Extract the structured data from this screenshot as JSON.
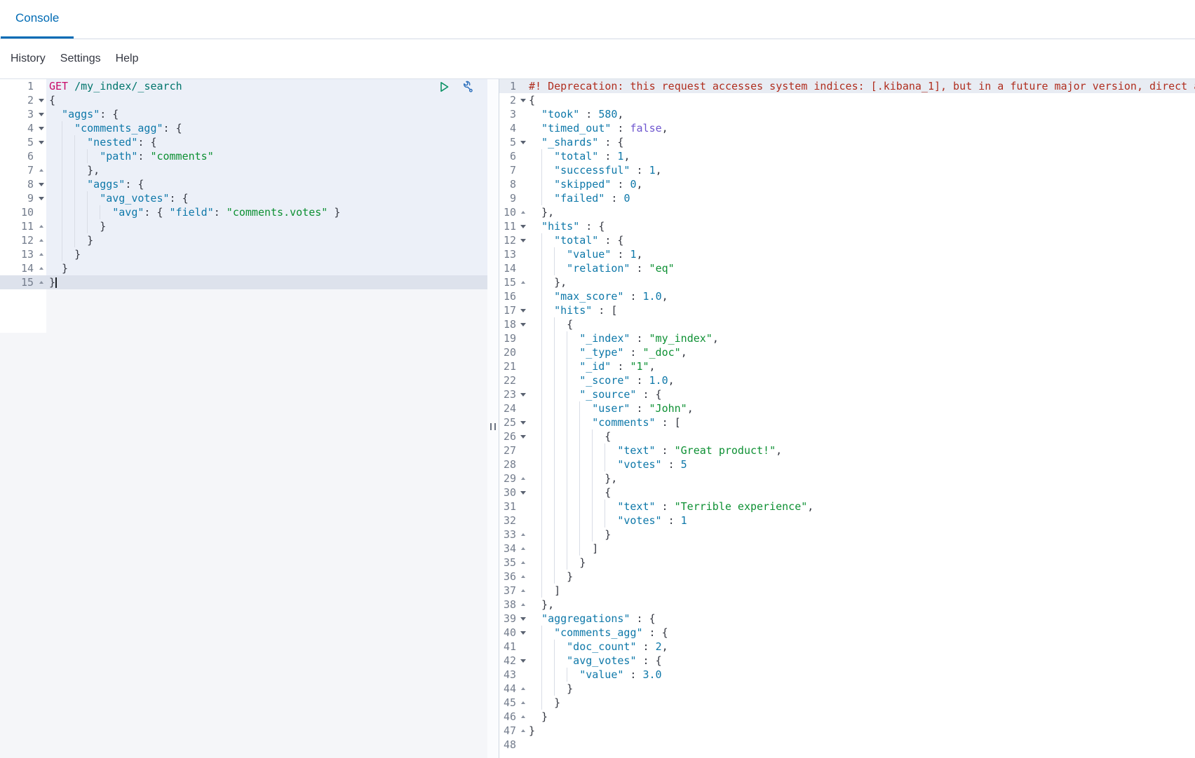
{
  "palette": {
    "accent": "#006bb4",
    "method": "#c80a68",
    "url": "#00756c",
    "key": "#0e78a9",
    "str": "#0d9033",
    "num": "#0e78a9",
    "bool": "#6e56cf",
    "punct": "#343741",
    "warn": "#b02e1f",
    "play_icon": "#0a9164",
    "wrench_icon": "#2a6ebb"
  },
  "tabs": {
    "console": "Console"
  },
  "menu": {
    "history": "History",
    "settings": "Settings",
    "help": "Help"
  },
  "request_editor": {
    "lines": [
      {
        "n": 1,
        "fold": "",
        "indent": 0,
        "tokens": [
          [
            "method",
            "GET "
          ],
          [
            "url",
            "/my_index/_search"
          ]
        ]
      },
      {
        "n": 2,
        "fold": "open",
        "indent": 0,
        "tokens": [
          [
            "punct",
            "{"
          ]
        ]
      },
      {
        "n": 3,
        "fold": "open",
        "indent": 1,
        "tokens": [
          [
            "key",
            "\"aggs\""
          ],
          [
            "punct",
            ": {"
          ]
        ]
      },
      {
        "n": 4,
        "fold": "open",
        "indent": 2,
        "tokens": [
          [
            "key",
            "\"comments_agg\""
          ],
          [
            "punct",
            ": {"
          ]
        ]
      },
      {
        "n": 5,
        "fold": "open",
        "indent": 3,
        "tokens": [
          [
            "key",
            "\"nested\""
          ],
          [
            "punct",
            ": {"
          ]
        ]
      },
      {
        "n": 6,
        "fold": "",
        "indent": 4,
        "tokens": [
          [
            "key",
            "\"path\""
          ],
          [
            "punct",
            ": "
          ],
          [
            "str",
            "\"comments\""
          ]
        ]
      },
      {
        "n": 7,
        "fold": "close",
        "indent": 3,
        "tokens": [
          [
            "punct",
            "},"
          ]
        ]
      },
      {
        "n": 8,
        "fold": "open",
        "indent": 3,
        "tokens": [
          [
            "key",
            "\"aggs\""
          ],
          [
            "punct",
            ": {"
          ]
        ]
      },
      {
        "n": 9,
        "fold": "open",
        "indent": 4,
        "tokens": [
          [
            "key",
            "\"avg_votes\""
          ],
          [
            "punct",
            ": {"
          ]
        ]
      },
      {
        "n": 10,
        "fold": "",
        "indent": 5,
        "tokens": [
          [
            "key",
            "\"avg\""
          ],
          [
            "punct",
            ": { "
          ],
          [
            "key",
            "\"field\""
          ],
          [
            "punct",
            ": "
          ],
          [
            "str",
            "\"comments.votes\""
          ],
          [
            "punct",
            " }"
          ]
        ]
      },
      {
        "n": 11,
        "fold": "close",
        "indent": 4,
        "tokens": [
          [
            "punct",
            "}"
          ]
        ]
      },
      {
        "n": 12,
        "fold": "close",
        "indent": 3,
        "tokens": [
          [
            "punct",
            "}"
          ]
        ]
      },
      {
        "n": 13,
        "fold": "close",
        "indent": 2,
        "tokens": [
          [
            "punct",
            "}"
          ]
        ]
      },
      {
        "n": 14,
        "fold": "close",
        "indent": 1,
        "tokens": [
          [
            "punct",
            "}"
          ]
        ]
      },
      {
        "n": 15,
        "fold": "close",
        "indent": 0,
        "active": true,
        "cursor": true,
        "tokens": [
          [
            "punct",
            "}"
          ]
        ]
      }
    ]
  },
  "response_editor": {
    "lines": [
      {
        "n": 1,
        "fold": "",
        "indent": 0,
        "highlight": true,
        "tokens": [
          [
            "warn",
            "#! Deprecation: this request accesses system indices: [.kibana_1], but in a future major version, direct access"
          ]
        ]
      },
      {
        "n": 2,
        "fold": "open",
        "indent": 0,
        "tokens": [
          [
            "punct",
            "{"
          ]
        ]
      },
      {
        "n": 3,
        "fold": "",
        "indent": 1,
        "tokens": [
          [
            "key",
            "\"took\""
          ],
          [
            "punct",
            " : "
          ],
          [
            "num",
            "580"
          ],
          [
            "punct",
            ","
          ]
        ]
      },
      {
        "n": 4,
        "fold": "",
        "indent": 1,
        "tokens": [
          [
            "key",
            "\"timed_out\""
          ],
          [
            "punct",
            " : "
          ],
          [
            "bool",
            "false"
          ],
          [
            "punct",
            ","
          ]
        ]
      },
      {
        "n": 5,
        "fold": "open",
        "indent": 1,
        "tokens": [
          [
            "key",
            "\"_shards\""
          ],
          [
            "punct",
            " : {"
          ]
        ]
      },
      {
        "n": 6,
        "fold": "",
        "indent": 2,
        "tokens": [
          [
            "key",
            "\"total\""
          ],
          [
            "punct",
            " : "
          ],
          [
            "num",
            "1"
          ],
          [
            "punct",
            ","
          ]
        ]
      },
      {
        "n": 7,
        "fold": "",
        "indent": 2,
        "tokens": [
          [
            "key",
            "\"successful\""
          ],
          [
            "punct",
            " : "
          ],
          [
            "num",
            "1"
          ],
          [
            "punct",
            ","
          ]
        ]
      },
      {
        "n": 8,
        "fold": "",
        "indent": 2,
        "tokens": [
          [
            "key",
            "\"skipped\""
          ],
          [
            "punct",
            " : "
          ],
          [
            "num",
            "0"
          ],
          [
            "punct",
            ","
          ]
        ]
      },
      {
        "n": 9,
        "fold": "",
        "indent": 2,
        "tokens": [
          [
            "key",
            "\"failed\""
          ],
          [
            "punct",
            " : "
          ],
          [
            "num",
            "0"
          ]
        ]
      },
      {
        "n": 10,
        "fold": "close",
        "indent": 1,
        "tokens": [
          [
            "punct",
            "},"
          ]
        ]
      },
      {
        "n": 11,
        "fold": "open",
        "indent": 1,
        "tokens": [
          [
            "key",
            "\"hits\""
          ],
          [
            "punct",
            " : {"
          ]
        ]
      },
      {
        "n": 12,
        "fold": "open",
        "indent": 2,
        "tokens": [
          [
            "key",
            "\"total\""
          ],
          [
            "punct",
            " : {"
          ]
        ]
      },
      {
        "n": 13,
        "fold": "",
        "indent": 3,
        "tokens": [
          [
            "key",
            "\"value\""
          ],
          [
            "punct",
            " : "
          ],
          [
            "num",
            "1"
          ],
          [
            "punct",
            ","
          ]
        ]
      },
      {
        "n": 14,
        "fold": "",
        "indent": 3,
        "tokens": [
          [
            "key",
            "\"relation\""
          ],
          [
            "punct",
            " : "
          ],
          [
            "str",
            "\"eq\""
          ]
        ]
      },
      {
        "n": 15,
        "fold": "close",
        "indent": 2,
        "tokens": [
          [
            "punct",
            "},"
          ]
        ]
      },
      {
        "n": 16,
        "fold": "",
        "indent": 2,
        "tokens": [
          [
            "key",
            "\"max_score\""
          ],
          [
            "punct",
            " : "
          ],
          [
            "num",
            "1.0"
          ],
          [
            "punct",
            ","
          ]
        ]
      },
      {
        "n": 17,
        "fold": "open",
        "indent": 2,
        "tokens": [
          [
            "key",
            "\"hits\""
          ],
          [
            "punct",
            " : ["
          ]
        ]
      },
      {
        "n": 18,
        "fold": "open",
        "indent": 3,
        "tokens": [
          [
            "punct",
            "{"
          ]
        ]
      },
      {
        "n": 19,
        "fold": "",
        "indent": 4,
        "tokens": [
          [
            "key",
            "\"_index\""
          ],
          [
            "punct",
            " : "
          ],
          [
            "str",
            "\"my_index\""
          ],
          [
            "punct",
            ","
          ]
        ]
      },
      {
        "n": 20,
        "fold": "",
        "indent": 4,
        "tokens": [
          [
            "key",
            "\"_type\""
          ],
          [
            "punct",
            " : "
          ],
          [
            "str",
            "\"_doc\""
          ],
          [
            "punct",
            ","
          ]
        ]
      },
      {
        "n": 21,
        "fold": "",
        "indent": 4,
        "tokens": [
          [
            "key",
            "\"_id\""
          ],
          [
            "punct",
            " : "
          ],
          [
            "str",
            "\"1\""
          ],
          [
            "punct",
            ","
          ]
        ]
      },
      {
        "n": 22,
        "fold": "",
        "indent": 4,
        "tokens": [
          [
            "key",
            "\"_score\""
          ],
          [
            "punct",
            " : "
          ],
          [
            "num",
            "1.0"
          ],
          [
            "punct",
            ","
          ]
        ]
      },
      {
        "n": 23,
        "fold": "open",
        "indent": 4,
        "tokens": [
          [
            "key",
            "\"_source\""
          ],
          [
            "punct",
            " : {"
          ]
        ]
      },
      {
        "n": 24,
        "fold": "",
        "indent": 5,
        "tokens": [
          [
            "key",
            "\"user\""
          ],
          [
            "punct",
            " : "
          ],
          [
            "str",
            "\"John\""
          ],
          [
            "punct",
            ","
          ]
        ]
      },
      {
        "n": 25,
        "fold": "open",
        "indent": 5,
        "tokens": [
          [
            "key",
            "\"comments\""
          ],
          [
            "punct",
            " : ["
          ]
        ]
      },
      {
        "n": 26,
        "fold": "open",
        "indent": 6,
        "tokens": [
          [
            "punct",
            "{"
          ]
        ]
      },
      {
        "n": 27,
        "fold": "",
        "indent": 7,
        "tokens": [
          [
            "key",
            "\"text\""
          ],
          [
            "punct",
            " : "
          ],
          [
            "str",
            "\"Great product!\""
          ],
          [
            "punct",
            ","
          ]
        ]
      },
      {
        "n": 28,
        "fold": "",
        "indent": 7,
        "tokens": [
          [
            "key",
            "\"votes\""
          ],
          [
            "punct",
            " : "
          ],
          [
            "num",
            "5"
          ]
        ]
      },
      {
        "n": 29,
        "fold": "close",
        "indent": 6,
        "tokens": [
          [
            "punct",
            "},"
          ]
        ]
      },
      {
        "n": 30,
        "fold": "open",
        "indent": 6,
        "tokens": [
          [
            "punct",
            "{"
          ]
        ]
      },
      {
        "n": 31,
        "fold": "",
        "indent": 7,
        "tokens": [
          [
            "key",
            "\"text\""
          ],
          [
            "punct",
            " : "
          ],
          [
            "str",
            "\"Terrible experience\""
          ],
          [
            "punct",
            ","
          ]
        ]
      },
      {
        "n": 32,
        "fold": "",
        "indent": 7,
        "tokens": [
          [
            "key",
            "\"votes\""
          ],
          [
            "punct",
            " : "
          ],
          [
            "num",
            "1"
          ]
        ]
      },
      {
        "n": 33,
        "fold": "close",
        "indent": 6,
        "tokens": [
          [
            "punct",
            "}"
          ]
        ]
      },
      {
        "n": 34,
        "fold": "close",
        "indent": 5,
        "tokens": [
          [
            "punct",
            "]"
          ]
        ]
      },
      {
        "n": 35,
        "fold": "close",
        "indent": 4,
        "tokens": [
          [
            "punct",
            "}"
          ]
        ]
      },
      {
        "n": 36,
        "fold": "close",
        "indent": 3,
        "tokens": [
          [
            "punct",
            "}"
          ]
        ]
      },
      {
        "n": 37,
        "fold": "close",
        "indent": 2,
        "tokens": [
          [
            "punct",
            "]"
          ]
        ]
      },
      {
        "n": 38,
        "fold": "close",
        "indent": 1,
        "tokens": [
          [
            "punct",
            "},"
          ]
        ]
      },
      {
        "n": 39,
        "fold": "open",
        "indent": 1,
        "tokens": [
          [
            "key",
            "\"aggregations\""
          ],
          [
            "punct",
            " : {"
          ]
        ]
      },
      {
        "n": 40,
        "fold": "open",
        "indent": 2,
        "tokens": [
          [
            "key",
            "\"comments_agg\""
          ],
          [
            "punct",
            " : {"
          ]
        ]
      },
      {
        "n": 41,
        "fold": "",
        "indent": 3,
        "tokens": [
          [
            "key",
            "\"doc_count\""
          ],
          [
            "punct",
            " : "
          ],
          [
            "num",
            "2"
          ],
          [
            "punct",
            ","
          ]
        ]
      },
      {
        "n": 42,
        "fold": "open",
        "indent": 3,
        "tokens": [
          [
            "key",
            "\"avg_votes\""
          ],
          [
            "punct",
            " : {"
          ]
        ]
      },
      {
        "n": 43,
        "fold": "",
        "indent": 4,
        "tokens": [
          [
            "key",
            "\"value\""
          ],
          [
            "punct",
            " : "
          ],
          [
            "num",
            "3.0"
          ]
        ]
      },
      {
        "n": 44,
        "fold": "close",
        "indent": 3,
        "tokens": [
          [
            "punct",
            "}"
          ]
        ]
      },
      {
        "n": 45,
        "fold": "close",
        "indent": 2,
        "tokens": [
          [
            "punct",
            "}"
          ]
        ]
      },
      {
        "n": 46,
        "fold": "close",
        "indent": 1,
        "tokens": [
          [
            "punct",
            "}"
          ]
        ]
      },
      {
        "n": 47,
        "fold": "close",
        "indent": 0,
        "tokens": [
          [
            "punct",
            "}"
          ]
        ]
      },
      {
        "n": 48,
        "fold": "",
        "indent": 0,
        "tokens": []
      }
    ]
  }
}
